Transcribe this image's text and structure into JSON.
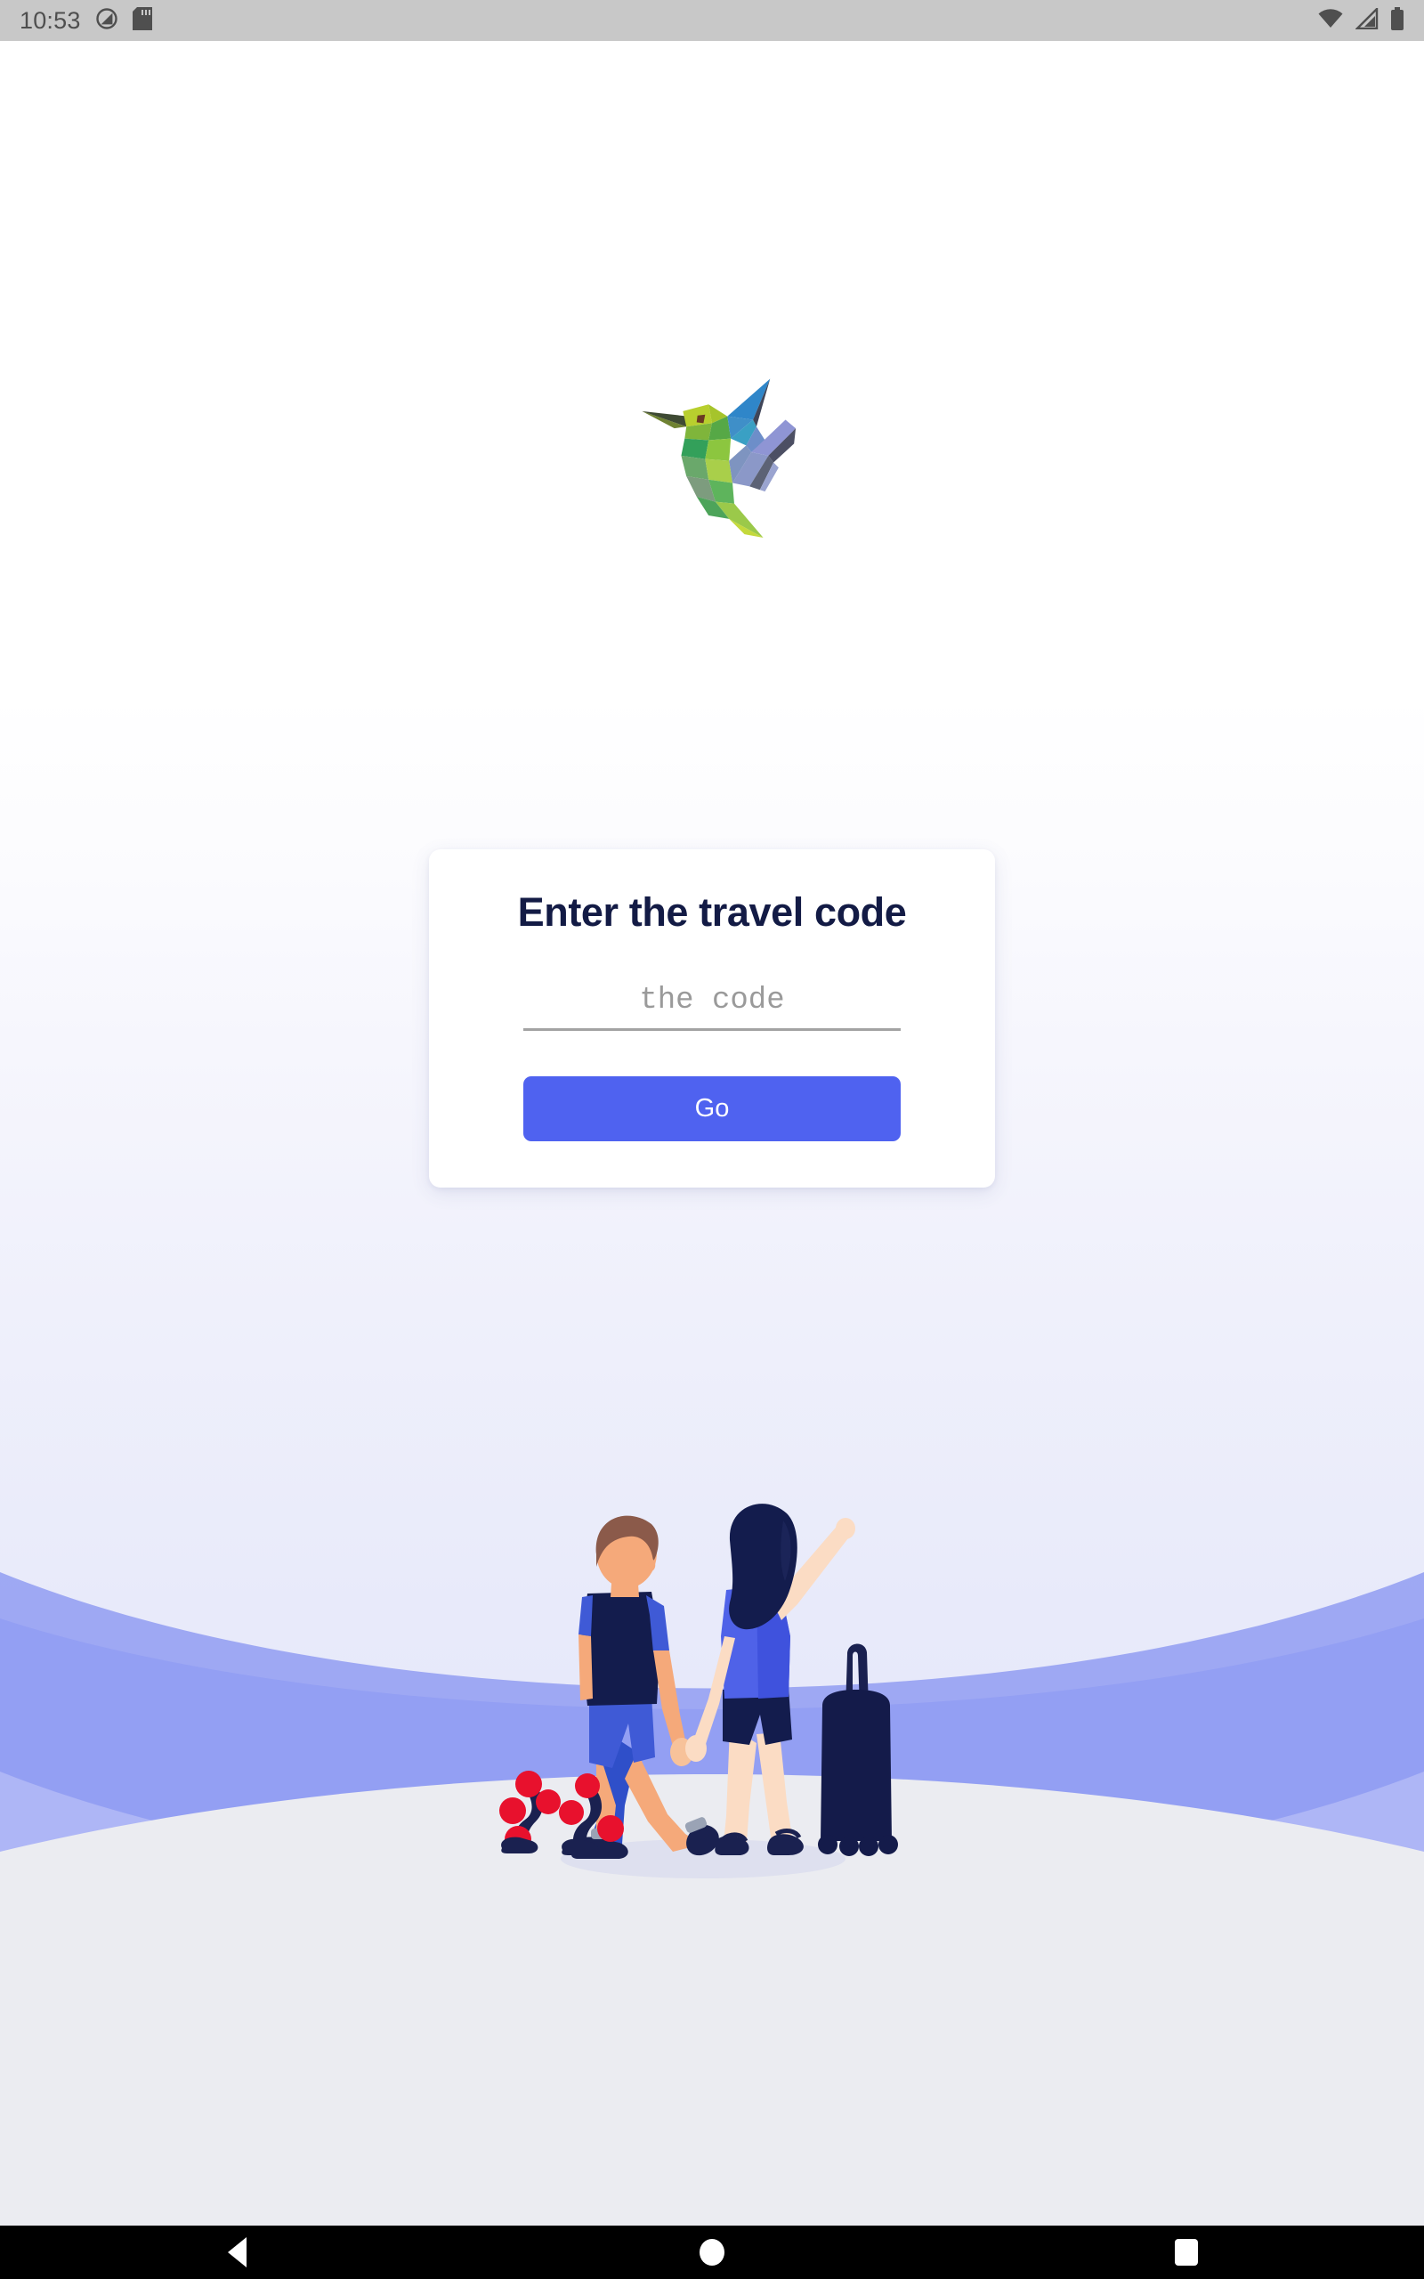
{
  "status_bar": {
    "time": "10:53",
    "icons": [
      "do-not-disturb-icon",
      "sd-card-icon",
      "wifi-icon",
      "cellular-signal-icon",
      "battery-icon"
    ]
  },
  "logo": {
    "name": "hummingbird-logo"
  },
  "card": {
    "title": "Enter the travel code",
    "input": {
      "placeholder": "the code",
      "value": ""
    },
    "submit_label": "Go"
  },
  "illustration": {
    "name": "travel-couple-illustration",
    "elements": [
      "man-walking",
      "woman-pointing",
      "rolling-suitcase",
      "red-flowers",
      "ground-shadow"
    ]
  },
  "nav_bar": {
    "back_label": "Back",
    "home_label": "Home",
    "recents_label": "Recents"
  },
  "colors": {
    "accent": "#4f62f0",
    "heading": "#131b45",
    "placeholder": "#9a9a9a",
    "card_bg": "#ffffff",
    "status_bar_bg": "#c8c8c8",
    "wave_light": "#c9cdf6",
    "wave_mid": "#aeb6f6",
    "wave_dark": "#8e9af2",
    "ground": "#ebecf1",
    "navy": "#1a1f4d"
  }
}
